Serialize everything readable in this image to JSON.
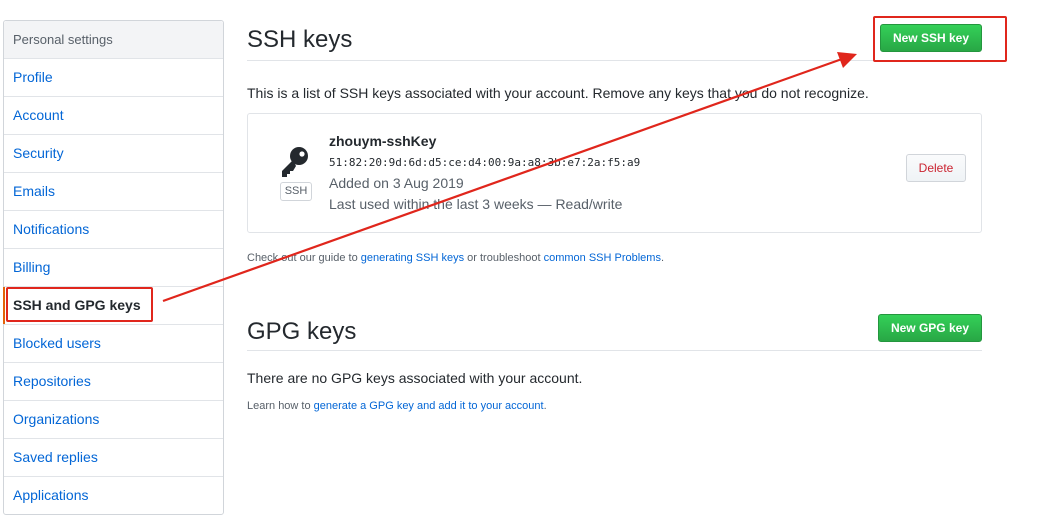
{
  "sidebar": {
    "header": "Personal settings",
    "items": [
      {
        "label": "Profile"
      },
      {
        "label": "Account"
      },
      {
        "label": "Security"
      },
      {
        "label": "Emails"
      },
      {
        "label": "Notifications"
      },
      {
        "label": "Billing"
      },
      {
        "label": "SSH and GPG keys",
        "selected": true
      },
      {
        "label": "Blocked users"
      },
      {
        "label": "Repositories"
      },
      {
        "label": "Organizations"
      },
      {
        "label": "Saved replies"
      },
      {
        "label": "Applications"
      }
    ]
  },
  "ssh": {
    "title": "SSH keys",
    "new_button": "New SSH key",
    "description": "This is a list of SSH keys associated with your account. Remove any keys that you do not recognize.",
    "key": {
      "badge": "SSH",
      "name": "zhouym-sshKey",
      "fingerprint": "51:82:20:9d:6d:d5:ce:d4:00:9a:a8:3b:e7:2a:f5:a9",
      "added": "Added on 3 Aug 2019",
      "last_used": "Last used within the last 3 weeks — Read/write",
      "delete_button": "Delete"
    },
    "note_prefix": "Check out our guide to ",
    "note_link1": "generating SSH keys",
    "note_middle": " or troubleshoot ",
    "note_link2": "common SSH Problems",
    "note_suffix": "."
  },
  "gpg": {
    "title": "GPG keys",
    "new_button": "New GPG key",
    "empty": "There are no GPG keys associated with your account.",
    "note_prefix": "Learn how to ",
    "note_link": "generate a GPG key and add it to your account",
    "note_suffix": "."
  },
  "annotation_color": "#e0261c",
  "icons": {
    "key": "key-icon"
  }
}
